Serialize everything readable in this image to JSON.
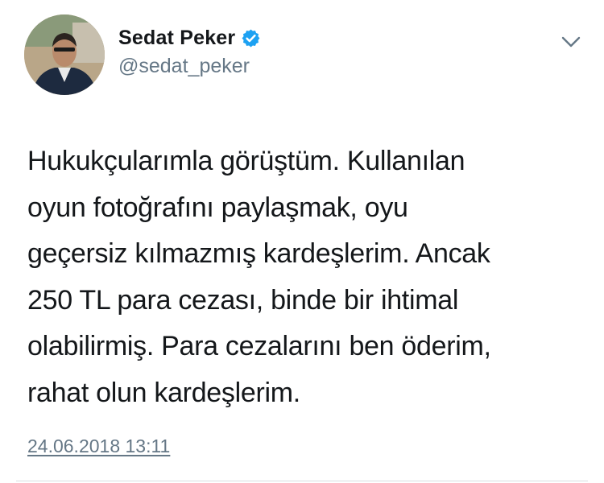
{
  "author": {
    "display_name": "Sedat Peker",
    "handle": "@sedat_peker",
    "verified": true
  },
  "tweet": {
    "lines": [
      "Hukukçularımla görüştüm. Kullanılan",
      "oyun fotoğrafını paylaşmak, oyu",
      "geçersiz kılmazmış kardeşlerim. Ancak",
      "250 TL para cezası, binde bir ihtimal",
      "olabilirmiş. Para cezalarını ben öderim,",
      "rahat olun kardeşlerim."
    ],
    "timestamp": "24.06.2018 13:11"
  },
  "icons": {
    "verified": "verified-badge-icon",
    "menu": "chevron-down-icon"
  },
  "colors": {
    "text": "#14171a",
    "secondary_text": "#657786",
    "verified_blue": "#1da1f2",
    "divider": "#d8dde1"
  }
}
